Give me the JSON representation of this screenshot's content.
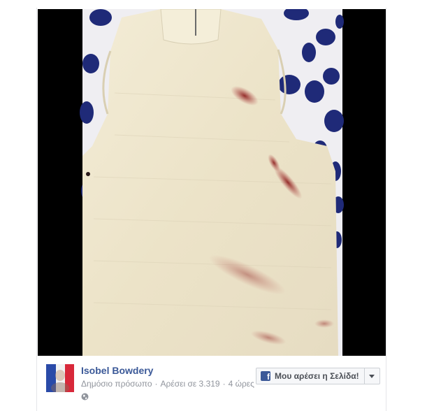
{
  "post": {
    "page_name": "Isobel Bowdery",
    "meta": {
      "audience": "Δημόσιο πρόσωπο",
      "likes": "Αρέσει σε 3.319",
      "time": "4 ώρες",
      "separator": "·"
    },
    "privacy_icon": "globe-icon",
    "avatar_icon": "french-flag-profile-picture"
  },
  "like_button": {
    "label": "Μου αρέσει η Σελίδα!",
    "icon": "facebook-icon",
    "dropdown_icon": "chevron-down-icon"
  },
  "colors": {
    "brand": "#3b5998",
    "meta_text": "#90949c",
    "photo_background": "#000000"
  }
}
